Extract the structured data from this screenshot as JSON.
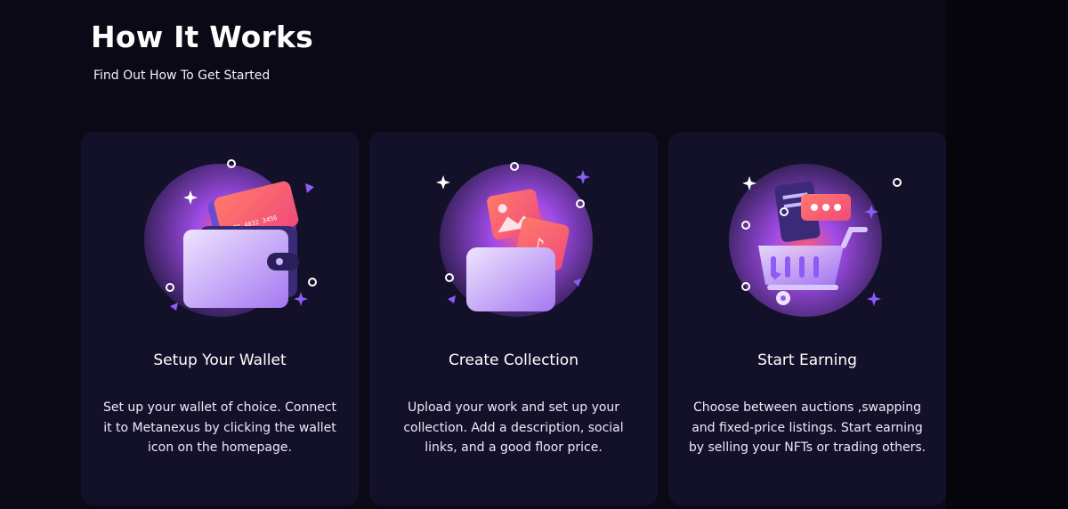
{
  "section": {
    "title": "How It Works",
    "subtitle": "Find Out How To Get Started"
  },
  "steps": [
    {
      "icon": "wallet-icon",
      "title": "Setup Your Wallet",
      "description": "Set up your wallet of choice. Connect it to Metanexus by clicking the wallet icon on the homepage.",
      "card_number_text": "5679 4032 3456"
    },
    {
      "icon": "collection-folder-icon",
      "title": "Create Collection",
      "description": "Upload your work and set up your collection. Add a description, social links, and a good floor price."
    },
    {
      "icon": "shopping-cart-icon",
      "title": "Start Earning",
      "description": "Choose between auctions ,swapping and fixed-price listings. Start earning by selling your NFTs or trading others."
    }
  ],
  "colors": {
    "background": "#0b0916",
    "card": "#13112a",
    "accent_purple": "#8b4cf6",
    "accent_coral": "#ff6b6b"
  }
}
